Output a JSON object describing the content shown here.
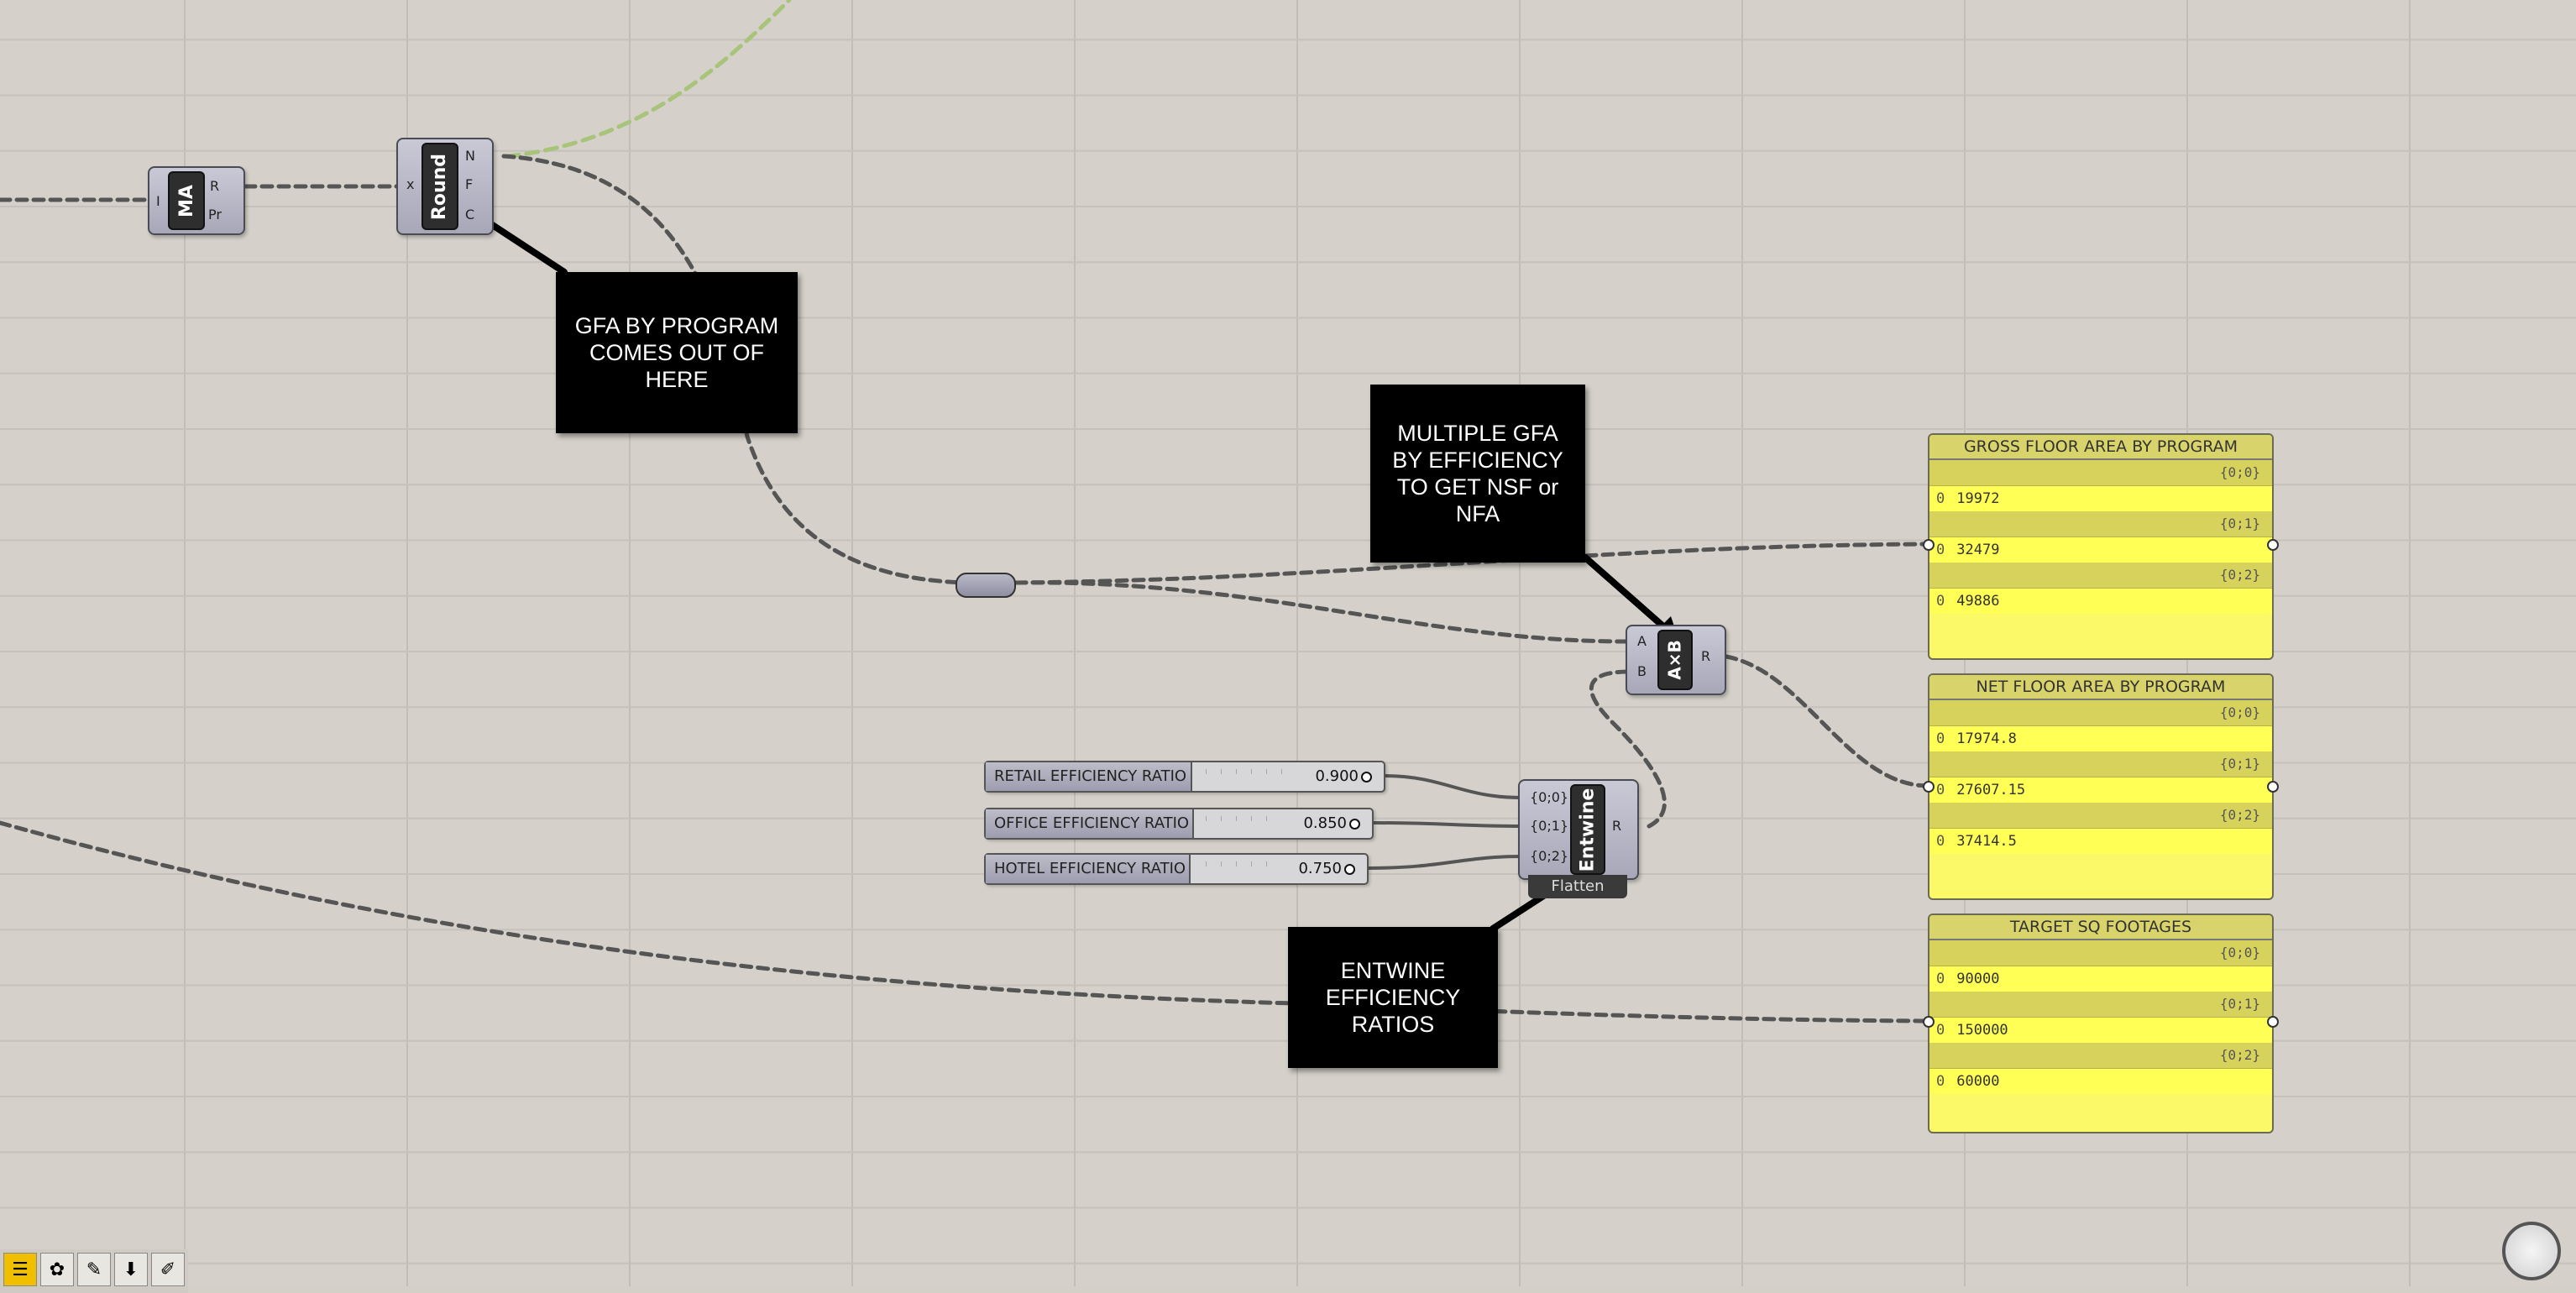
{
  "components": {
    "mass_addition": {
      "label": "MA",
      "inputs": [
        "I"
      ],
      "outputs": [
        "R",
        "Pr"
      ]
    },
    "round": {
      "label": "Round",
      "inputs": [
        "x"
      ],
      "outputs": [
        "N",
        "F",
        "C"
      ]
    },
    "multiply": {
      "label": "A×B",
      "inputs": [
        "A",
        "B"
      ],
      "outputs": [
        "R"
      ]
    },
    "entwine": {
      "label": "Entwine",
      "inputs": [
        "{0;0}",
        "{0;1}",
        "{0;2}"
      ],
      "outputs": [
        "R"
      ],
      "footer": "Flatten"
    }
  },
  "notes": {
    "gfa": "GFA BY PROGRAM COMES OUT OF HERE",
    "multiply": "MULTIPLE GFA BY EFFICIENCY TO GET NSF or NFA",
    "entwine": "ENTWINE EFFICIENCY RATIOS"
  },
  "sliders": [
    {
      "label": "RETAIL EFFICIENCY RATIO",
      "value": "0.900"
    },
    {
      "label": "OFFICE EFFICIENCY RATIO",
      "value": "0.850"
    },
    {
      "label": "HOTEL EFFICIENCY RATIO",
      "value": "0.750"
    }
  ],
  "panels": [
    {
      "title": "GROSS FLOOR AREA BY PROGRAM",
      "branches": [
        {
          "path": "{0;0}",
          "index": "0",
          "value": "19972"
        },
        {
          "path": "{0;1}",
          "index": "0",
          "value": "32479"
        },
        {
          "path": "{0;2}",
          "index": "0",
          "value": "49886"
        }
      ]
    },
    {
      "title": "NET FLOOR AREA BY PROGRAM",
      "branches": [
        {
          "path": "{0;0}",
          "index": "0",
          "value": "17974.8"
        },
        {
          "path": "{0;1}",
          "index": "0",
          "value": "27607.15"
        },
        {
          "path": "{0;2}",
          "index": "0",
          "value": "37414.5"
        }
      ]
    },
    {
      "title": "TARGET SQ FOOTAGES",
      "branches": [
        {
          "path": "{0;0}",
          "index": "0",
          "value": "90000"
        },
        {
          "path": "{0;1}",
          "index": "0",
          "value": "150000"
        },
        {
          "path": "{0;2}",
          "index": "0",
          "value": "60000"
        }
      ]
    }
  ],
  "toolbar": {
    "items": [
      "grasshopper-icon",
      "sprout-icon",
      "sketch-icon",
      "bake-icon",
      "pick-icon"
    ]
  },
  "colors": {
    "panel_fill": "#ffff55",
    "note_fill": "#000000",
    "canvas": "#d5d1ca",
    "selected_wire": "#a8c47a"
  }
}
